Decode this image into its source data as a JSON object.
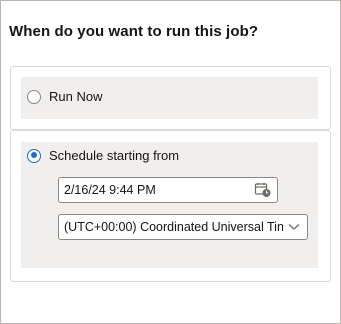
{
  "header": {
    "title": "When do you want to run this job?"
  },
  "options": {
    "run_now": {
      "label": "Run Now",
      "selected": false
    },
    "schedule": {
      "label": "Schedule starting from",
      "selected": true
    }
  },
  "schedule": {
    "datetime_value": "2/16/24 9:44 PM",
    "timezone_value": "(UTC+00:00) Coordinated Universal Tin"
  },
  "icons": {
    "calendar": "calendar-clock-icon",
    "dropdown": "chevron-down-icon"
  },
  "colors": {
    "accent": "#1b6ec2",
    "panel": "#f1efed",
    "border": "#dcd9d5"
  }
}
